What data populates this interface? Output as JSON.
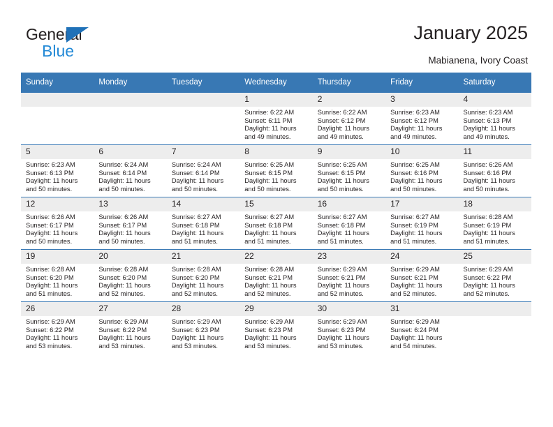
{
  "brand": {
    "name_top": "General",
    "name_bottom": "Blue",
    "color_blue": "#2389d6",
    "color_triangle": "#1f71b8"
  },
  "header": {
    "title": "January 2025",
    "subtitle": "Mabianena, Ivory Coast"
  },
  "theme": {
    "header_bg": "#3878b4",
    "daynum_bg": "#ededed",
    "text": "#231f20"
  },
  "calendar": {
    "weekday_headers": [
      "Sunday",
      "Monday",
      "Tuesday",
      "Wednesday",
      "Thursday",
      "Friday",
      "Saturday"
    ],
    "weeks": [
      [
        {
          "day": "",
          "blank": true
        },
        {
          "day": "",
          "blank": true
        },
        {
          "day": "",
          "blank": true
        },
        {
          "day": "1",
          "sunrise": "Sunrise: 6:22 AM",
          "sunset": "Sunset: 6:11 PM",
          "daylight": "Daylight: 11 hours and 49 minutes."
        },
        {
          "day": "2",
          "sunrise": "Sunrise: 6:22 AM",
          "sunset": "Sunset: 6:12 PM",
          "daylight": "Daylight: 11 hours and 49 minutes."
        },
        {
          "day": "3",
          "sunrise": "Sunrise: 6:23 AM",
          "sunset": "Sunset: 6:12 PM",
          "daylight": "Daylight: 11 hours and 49 minutes."
        },
        {
          "day": "4",
          "sunrise": "Sunrise: 6:23 AM",
          "sunset": "Sunset: 6:13 PM",
          "daylight": "Daylight: 11 hours and 49 minutes."
        }
      ],
      [
        {
          "day": "5",
          "sunrise": "Sunrise: 6:23 AM",
          "sunset": "Sunset: 6:13 PM",
          "daylight": "Daylight: 11 hours and 50 minutes."
        },
        {
          "day": "6",
          "sunrise": "Sunrise: 6:24 AM",
          "sunset": "Sunset: 6:14 PM",
          "daylight": "Daylight: 11 hours and 50 minutes."
        },
        {
          "day": "7",
          "sunrise": "Sunrise: 6:24 AM",
          "sunset": "Sunset: 6:14 PM",
          "daylight": "Daylight: 11 hours and 50 minutes."
        },
        {
          "day": "8",
          "sunrise": "Sunrise: 6:25 AM",
          "sunset": "Sunset: 6:15 PM",
          "daylight": "Daylight: 11 hours and 50 minutes."
        },
        {
          "day": "9",
          "sunrise": "Sunrise: 6:25 AM",
          "sunset": "Sunset: 6:15 PM",
          "daylight": "Daylight: 11 hours and 50 minutes."
        },
        {
          "day": "10",
          "sunrise": "Sunrise: 6:25 AM",
          "sunset": "Sunset: 6:16 PM",
          "daylight": "Daylight: 11 hours and 50 minutes."
        },
        {
          "day": "11",
          "sunrise": "Sunrise: 6:26 AM",
          "sunset": "Sunset: 6:16 PM",
          "daylight": "Daylight: 11 hours and 50 minutes."
        }
      ],
      [
        {
          "day": "12",
          "sunrise": "Sunrise: 6:26 AM",
          "sunset": "Sunset: 6:17 PM",
          "daylight": "Daylight: 11 hours and 50 minutes."
        },
        {
          "day": "13",
          "sunrise": "Sunrise: 6:26 AM",
          "sunset": "Sunset: 6:17 PM",
          "daylight": "Daylight: 11 hours and 50 minutes."
        },
        {
          "day": "14",
          "sunrise": "Sunrise: 6:27 AM",
          "sunset": "Sunset: 6:18 PM",
          "daylight": "Daylight: 11 hours and 51 minutes."
        },
        {
          "day": "15",
          "sunrise": "Sunrise: 6:27 AM",
          "sunset": "Sunset: 6:18 PM",
          "daylight": "Daylight: 11 hours and 51 minutes."
        },
        {
          "day": "16",
          "sunrise": "Sunrise: 6:27 AM",
          "sunset": "Sunset: 6:18 PM",
          "daylight": "Daylight: 11 hours and 51 minutes."
        },
        {
          "day": "17",
          "sunrise": "Sunrise: 6:27 AM",
          "sunset": "Sunset: 6:19 PM",
          "daylight": "Daylight: 11 hours and 51 minutes."
        },
        {
          "day": "18",
          "sunrise": "Sunrise: 6:28 AM",
          "sunset": "Sunset: 6:19 PM",
          "daylight": "Daylight: 11 hours and 51 minutes."
        }
      ],
      [
        {
          "day": "19",
          "sunrise": "Sunrise: 6:28 AM",
          "sunset": "Sunset: 6:20 PM",
          "daylight": "Daylight: 11 hours and 51 minutes."
        },
        {
          "day": "20",
          "sunrise": "Sunrise: 6:28 AM",
          "sunset": "Sunset: 6:20 PM",
          "daylight": "Daylight: 11 hours and 52 minutes."
        },
        {
          "day": "21",
          "sunrise": "Sunrise: 6:28 AM",
          "sunset": "Sunset: 6:20 PM",
          "daylight": "Daylight: 11 hours and 52 minutes."
        },
        {
          "day": "22",
          "sunrise": "Sunrise: 6:28 AM",
          "sunset": "Sunset: 6:21 PM",
          "daylight": "Daylight: 11 hours and 52 minutes."
        },
        {
          "day": "23",
          "sunrise": "Sunrise: 6:29 AM",
          "sunset": "Sunset: 6:21 PM",
          "daylight": "Daylight: 11 hours and 52 minutes."
        },
        {
          "day": "24",
          "sunrise": "Sunrise: 6:29 AM",
          "sunset": "Sunset: 6:21 PM",
          "daylight": "Daylight: 11 hours and 52 minutes."
        },
        {
          "day": "25",
          "sunrise": "Sunrise: 6:29 AM",
          "sunset": "Sunset: 6:22 PM",
          "daylight": "Daylight: 11 hours and 52 minutes."
        }
      ],
      [
        {
          "day": "26",
          "sunrise": "Sunrise: 6:29 AM",
          "sunset": "Sunset: 6:22 PM",
          "daylight": "Daylight: 11 hours and 53 minutes."
        },
        {
          "day": "27",
          "sunrise": "Sunrise: 6:29 AM",
          "sunset": "Sunset: 6:22 PM",
          "daylight": "Daylight: 11 hours and 53 minutes."
        },
        {
          "day": "28",
          "sunrise": "Sunrise: 6:29 AM",
          "sunset": "Sunset: 6:23 PM",
          "daylight": "Daylight: 11 hours and 53 minutes."
        },
        {
          "day": "29",
          "sunrise": "Sunrise: 6:29 AM",
          "sunset": "Sunset: 6:23 PM",
          "daylight": "Daylight: 11 hours and 53 minutes."
        },
        {
          "day": "30",
          "sunrise": "Sunrise: 6:29 AM",
          "sunset": "Sunset: 6:23 PM",
          "daylight": "Daylight: 11 hours and 53 minutes."
        },
        {
          "day": "31",
          "sunrise": "Sunrise: 6:29 AM",
          "sunset": "Sunset: 6:24 PM",
          "daylight": "Daylight: 11 hours and 54 minutes."
        },
        {
          "day": "",
          "blank": true
        }
      ]
    ]
  }
}
